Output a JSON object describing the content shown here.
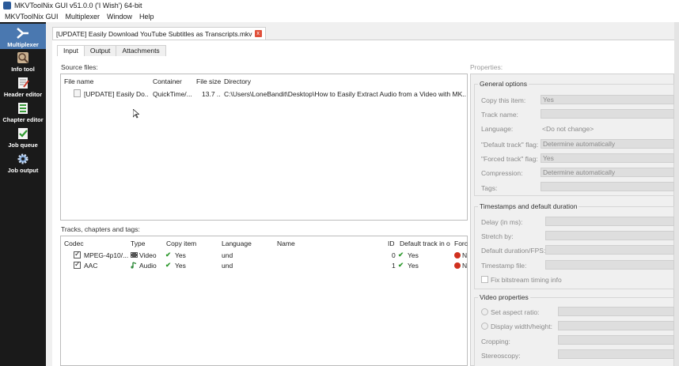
{
  "window": {
    "title": "MKVToolNix GUI v51.0.0 ('I Wish') 64-bit"
  },
  "menu": [
    "MKVToolNix GUI",
    "Multiplexer",
    "Window",
    "Help"
  ],
  "sidebar": [
    {
      "label": "Multiplexer",
      "active": true
    },
    {
      "label": "Info tool"
    },
    {
      "label": "Header editor"
    },
    {
      "label": "Chapter editor"
    },
    {
      "label": "Job queue"
    },
    {
      "label": "Job output"
    }
  ],
  "document_tab": {
    "title": "[UPDATE] Easily Download YouTube Subtitles as Transcripts.mkv",
    "close": "x"
  },
  "subtabs": [
    "Input",
    "Output",
    "Attachments"
  ],
  "source_files": {
    "label": "Source files:",
    "columns": [
      "File name",
      "Container",
      "File size",
      "Directory"
    ],
    "rows": [
      {
        "name": "[UPDATE] Easily Do...",
        "container": "QuickTime/...",
        "size": "13.7 ...",
        "directory": "C:\\Users\\LoneBandit\\Desktop\\How to Easily Extract Audio from a Video with MK..."
      }
    ]
  },
  "tracks": {
    "label": "Tracks, chapters and tags:",
    "columns": [
      "Codec",
      "Type",
      "Copy item",
      "Language",
      "Name",
      "ID",
      "Default track in o",
      "Forc"
    ],
    "rows": [
      {
        "codec": "MPEG-4p10/...",
        "type": "Video",
        "copy": "Yes",
        "language": "und",
        "name": "",
        "id": "0",
        "default": "Yes",
        "forced": "N"
      },
      {
        "codec": "AAC",
        "type": "Audio",
        "copy": "Yes",
        "language": "und",
        "name": "",
        "id": "1",
        "default": "Yes",
        "forced": "N"
      }
    ]
  },
  "properties": {
    "label": "Properties:",
    "general": {
      "title": "General options",
      "copy_item_label": "Copy this item:",
      "copy_item_value": "Yes",
      "track_name_label": "Track name:",
      "language_label": "Language:",
      "language_value": "<Do not change>",
      "default_flag_label": "\"Default track\" flag:",
      "default_flag_value": "Determine automatically",
      "forced_flag_label": "\"Forced track\" flag:",
      "forced_flag_value": "Yes",
      "compression_label": "Compression:",
      "compression_value": "Determine automatically",
      "tags_label": "Tags:"
    },
    "timestamps": {
      "title": "Timestamps and default duration",
      "delay_label": "Delay (in ms):",
      "stretch_label": "Stretch by:",
      "duration_label": "Default duration/FPS:",
      "ts_file_label": "Timestamp file:",
      "fix_label": "Fix bitstream timing info"
    },
    "video": {
      "title": "Video properties",
      "aspect_label": "Set aspect ratio:",
      "display_label": "Display width/height:",
      "cropping_label": "Cropping:",
      "stereo_label": "Stereoscopy:"
    }
  }
}
